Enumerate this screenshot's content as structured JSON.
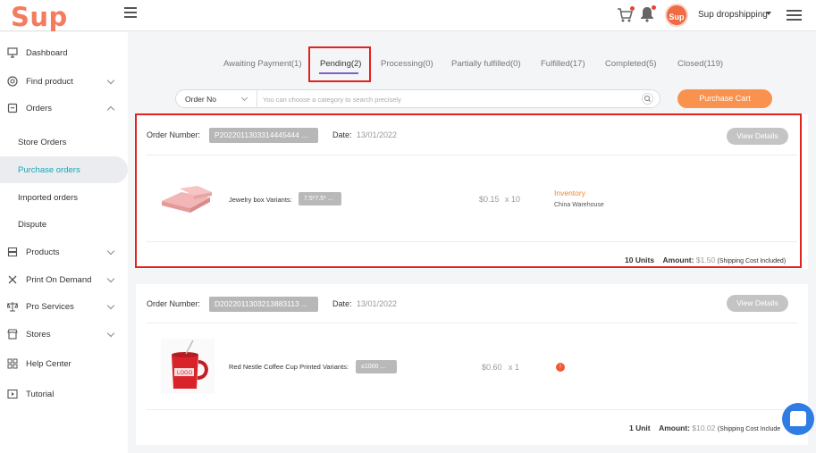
{
  "header": {
    "logo_text": "Sup",
    "avatar_text": "Sup",
    "store_name": "Sup dropshipping",
    "accent_color": "#f47b5c"
  },
  "sidebar": {
    "items": [
      {
        "label": "Dashboard",
        "icon": "monitor-icon"
      },
      {
        "label": "Find product",
        "icon": "search-circle-icon"
      },
      {
        "label": "Orders",
        "icon": "orders-icon"
      },
      {
        "label": "Store Orders"
      },
      {
        "label": "Purchase orders"
      },
      {
        "label": "Imported orders"
      },
      {
        "label": "Dispute"
      },
      {
        "label": "Products",
        "icon": "products-icon"
      },
      {
        "label": "Print On Demand",
        "icon": "tools-icon"
      },
      {
        "label": "Pro Services",
        "icon": "scale-icon"
      },
      {
        "label": "Stores",
        "icon": "store-icon"
      },
      {
        "label": "Help Center",
        "icon": "grid-icon"
      },
      {
        "label": "Tutorial",
        "icon": "play-icon"
      }
    ]
  },
  "tabs": [
    {
      "label": "Awaiting Payment(1)"
    },
    {
      "label": "Pending(2)"
    },
    {
      "label": "Processing(0)"
    },
    {
      "label": "Partially fulfilled(0)"
    },
    {
      "label": "Fulfilled(17)"
    },
    {
      "label": "Completed(5)"
    },
    {
      "label": "Closed(119)"
    }
  ],
  "search": {
    "category": "Order No",
    "placeholder": "You can choose a category to search precisely"
  },
  "purchase_cart_label": "Purchase Cart",
  "orders": [
    {
      "order_number_label": "Order Number:",
      "order_number": "P2022011303314445444 ...",
      "date_label": "Date:",
      "date": "13/01/2022",
      "view_label": "View Details",
      "product_name": "Jewelry box",
      "variants_label": "Variants:",
      "variant": "7.5*7.5* ...",
      "price": "$0.15",
      "qty": "x 10",
      "inventory": "Inventory",
      "warehouse": "China Warehouse",
      "units": "10 Units",
      "amount_label": "Amount:",
      "amount": "$1.50",
      "shipping_note": "(Shipping Cost Included)"
    },
    {
      "order_number_label": "Order Number:",
      "order_number": "D2022011303213883113 ...",
      "date_label": "Date:",
      "date": "13/01/2022",
      "view_label": "View Details",
      "product_name": "Red Nestle Coffee Cup Printed",
      "variants_label": "Variants:",
      "variant": "≤1000 ...",
      "price": "$0.60",
      "qty": "x 1",
      "units": "1 Unit",
      "amount_label": "Amount:",
      "amount": "$10.02",
      "shipping_note": "(Shipping Cost Include"
    }
  ]
}
